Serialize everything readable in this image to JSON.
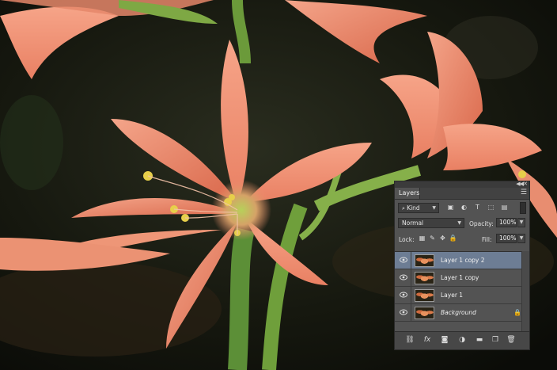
{
  "panel": {
    "tab_label": "Layers",
    "kind_label": "Kind",
    "blend_mode": "Normal",
    "opacity_label": "Opacity:",
    "opacity_value": "100%",
    "lock_label": "Lock:",
    "fill_label": "Fill:",
    "fill_value": "100%",
    "layers": [
      {
        "name": "Layer 1 copy 2",
        "selected": true
      },
      {
        "name": "Layer 1 copy",
        "selected": false
      },
      {
        "name": "Layer 1",
        "selected": false
      },
      {
        "name": "Background",
        "selected": false,
        "locked": true
      }
    ],
    "colors": {
      "panel_bg": "#535353",
      "selected_row": "#6d7d94"
    }
  },
  "icons": [
    "eye-icon",
    "lock-icon",
    "link-icon",
    "fx-icon",
    "mask-icon",
    "adjustment-icon",
    "folder-icon",
    "new-layer-icon",
    "trash-icon"
  ]
}
